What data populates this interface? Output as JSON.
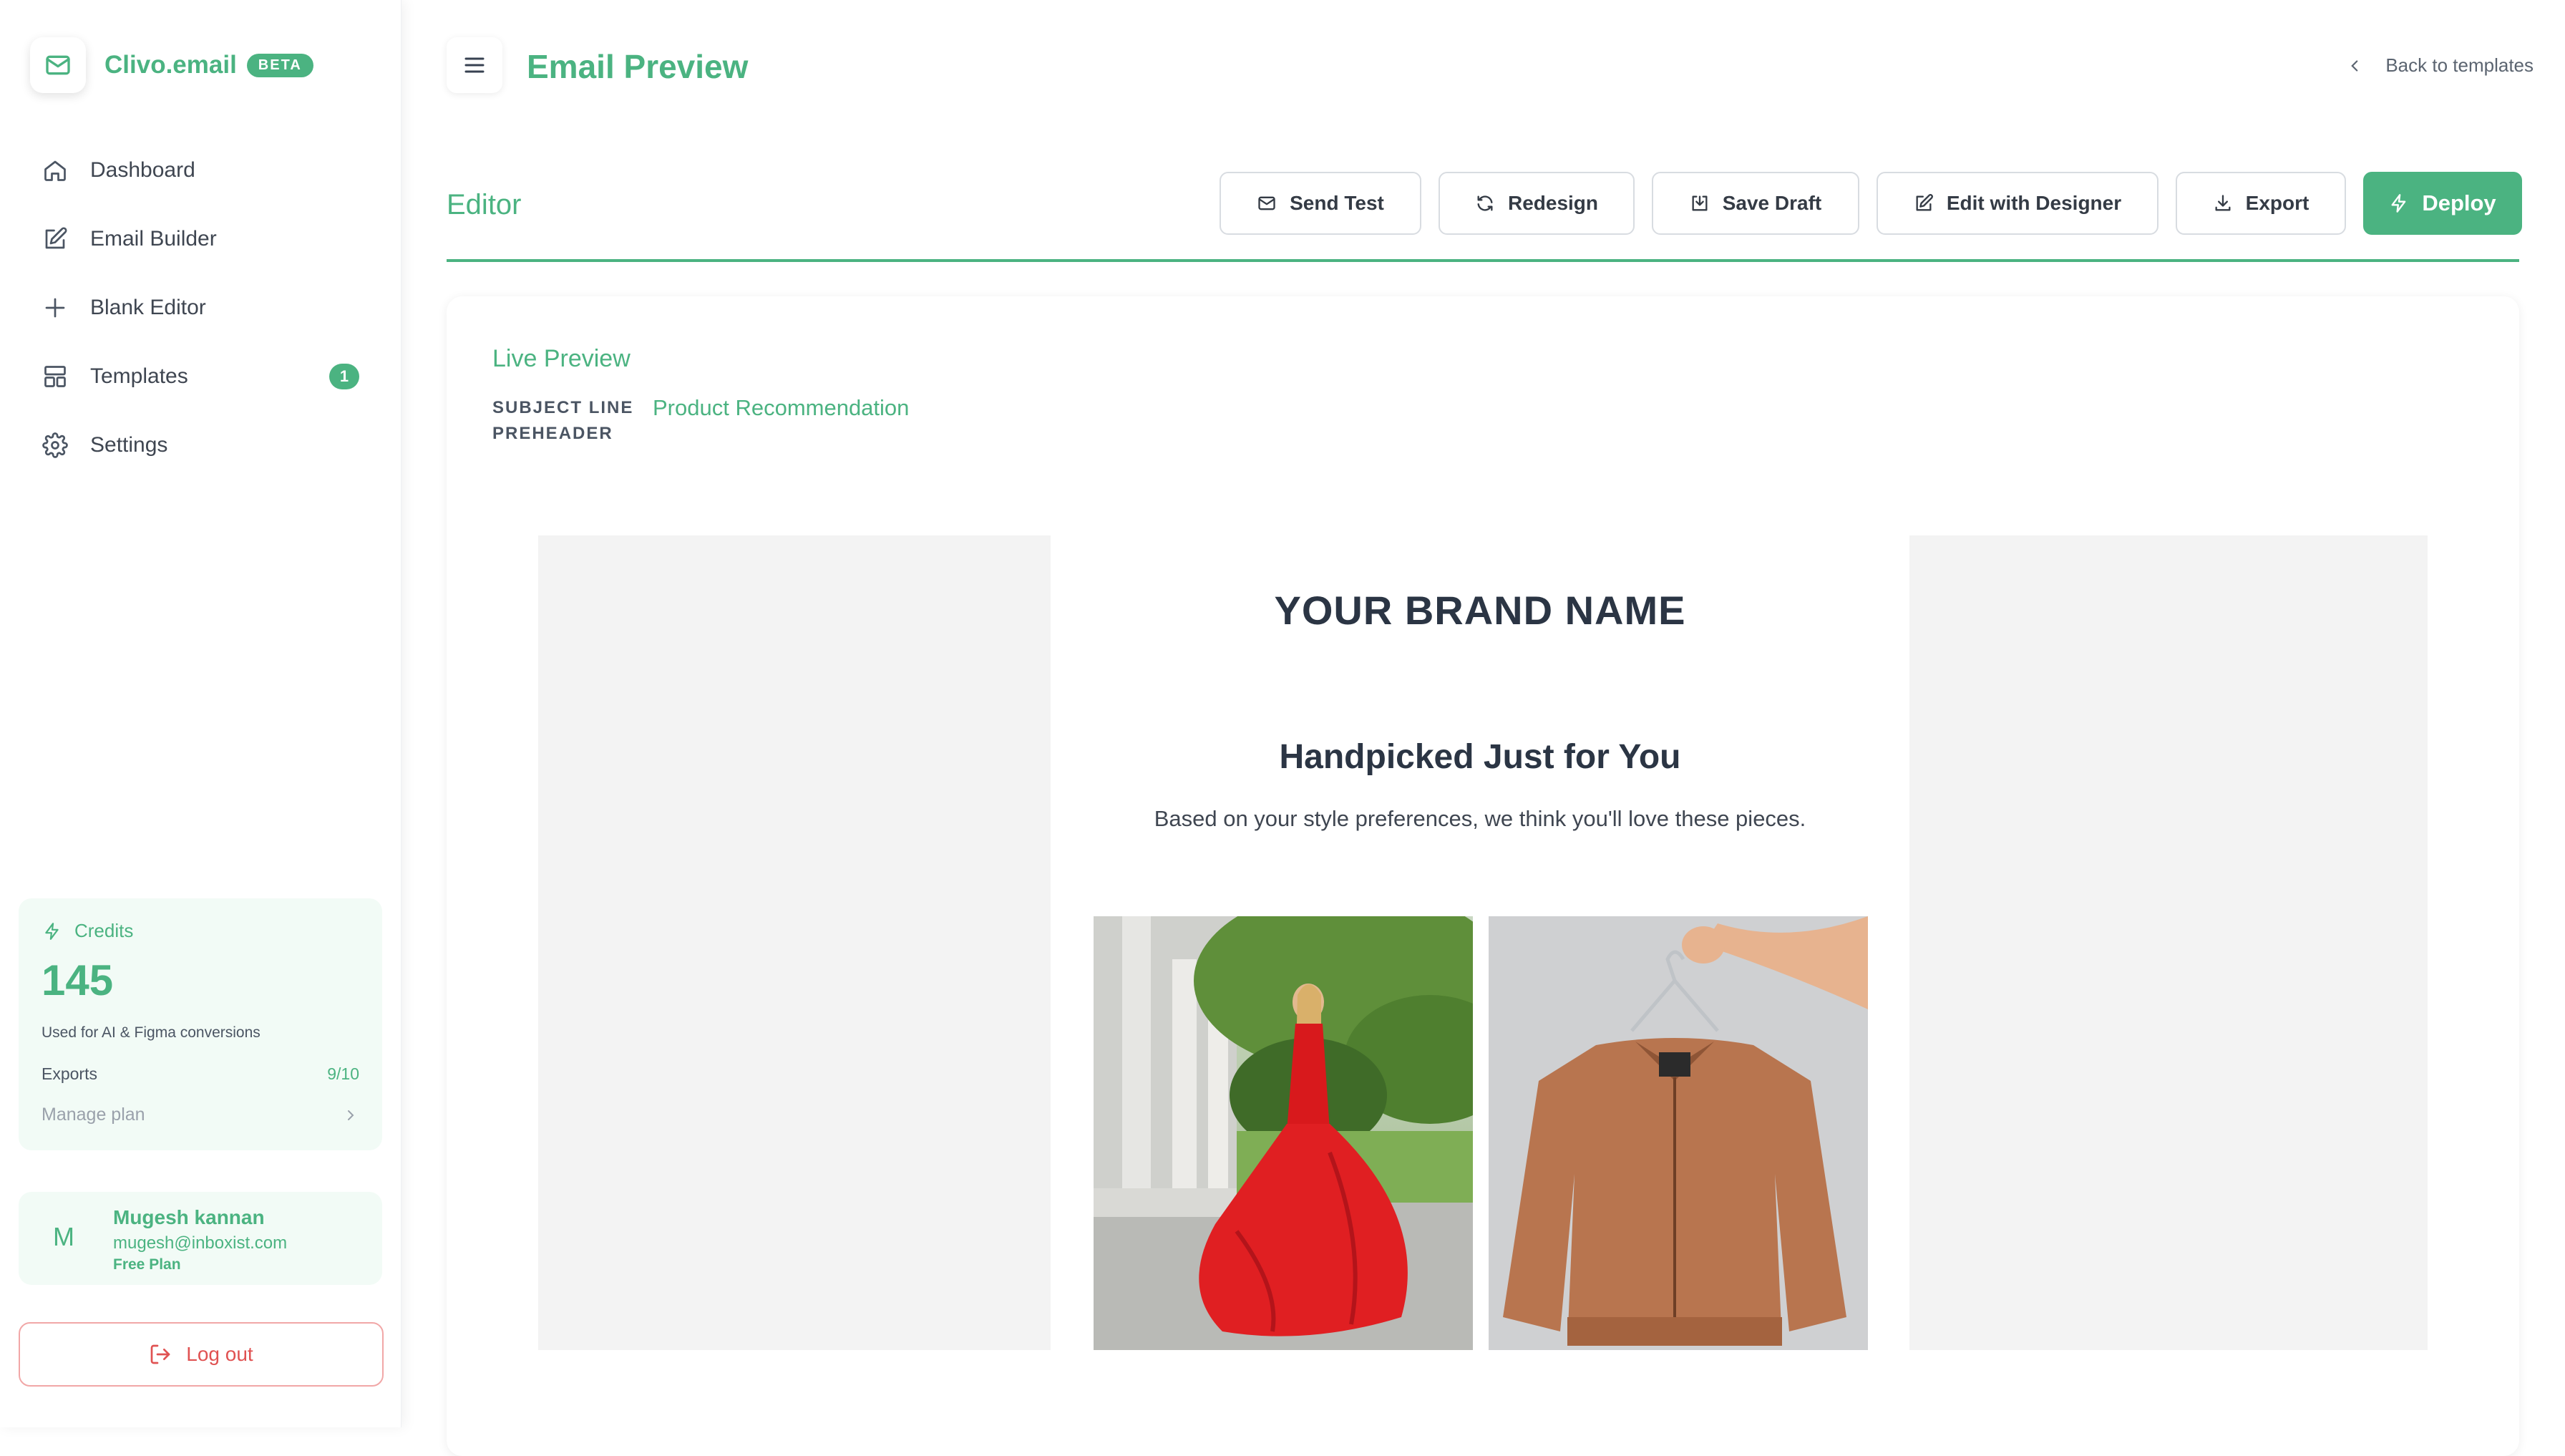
{
  "sidebar": {
    "brand_name": "Clivo.email",
    "beta_label": "BETA",
    "items": [
      {
        "label": "Dashboard",
        "icon": "home-icon"
      },
      {
        "label": "Email Builder",
        "icon": "edit-icon"
      },
      {
        "label": "Blank Editor",
        "icon": "plus-icon"
      },
      {
        "label": "Templates",
        "icon": "layout-icon",
        "badge": "1"
      },
      {
        "label": "Settings",
        "icon": "gear-icon"
      }
    ],
    "credits": {
      "label": "Credits",
      "value": "145",
      "description": "Used for AI & Figma conversions",
      "exports_label": "Exports",
      "exports_value": "9/10",
      "manage_label": "Manage plan"
    },
    "user": {
      "initial": "M",
      "name": "Mugesh kannan",
      "email": "mugesh@inboxist.com",
      "plan": "Free Plan"
    },
    "logout_label": "Log out"
  },
  "header": {
    "title": "Email Preview",
    "back_label": "Back to templates"
  },
  "editor": {
    "label": "Editor",
    "buttons": {
      "send_test": "Send Test",
      "redesign": "Redesign",
      "save_draft": "Save Draft",
      "edit_designer": "Edit with Designer",
      "export": "Export",
      "deploy": "Deploy"
    }
  },
  "preview": {
    "title": "Live Preview",
    "subject_key": "SUBJECT LINE",
    "subject_value": "Product Recommendation",
    "preheader_key": "PREHEADER",
    "email": {
      "brand": "YOUR BRAND NAME",
      "heading": "Handpicked Just for You",
      "text": "Based on your style preferences, we think you'll love these pieces."
    }
  },
  "colors": {
    "accent": "#4bb381",
    "logout": "#e05252",
    "text_dark": "#2b3544"
  }
}
